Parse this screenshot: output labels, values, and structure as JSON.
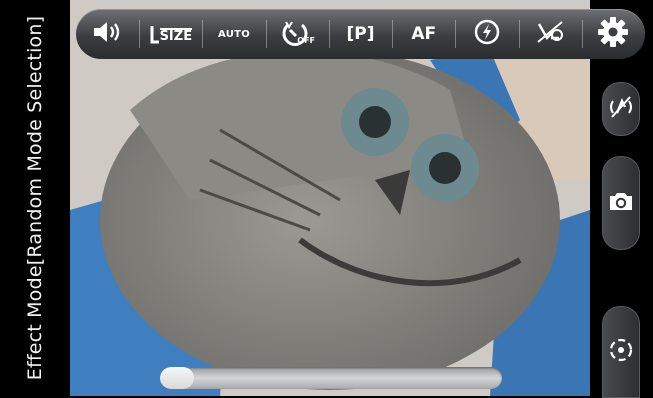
{
  "side_label": "Effect Mode[Random Mode Selection]",
  "toolbar": {
    "size_label": "SIZE",
    "auto_label": "AUTO",
    "timer_sub_label": "OFF",
    "program_label": "[P]",
    "focus_label": "AF",
    "icons": [
      "volume-icon",
      "image-size-icon",
      "white-balance-auto-icon",
      "self-timer-off-icon",
      "program-mode-icon",
      "autofocus-icon",
      "flash-auto-icon",
      "voice-shutter-off-icon",
      "gear-icon"
    ]
  },
  "right_panel": {
    "icons": [
      "stabilizer-off-icon",
      "camera-icon",
      "switch-camera-icon"
    ]
  },
  "progress": {
    "value": 0.1
  },
  "colors": {
    "toolbar": "#3c3d40",
    "accent": "#ffffff",
    "preview_blue": "#3f7fbf"
  }
}
